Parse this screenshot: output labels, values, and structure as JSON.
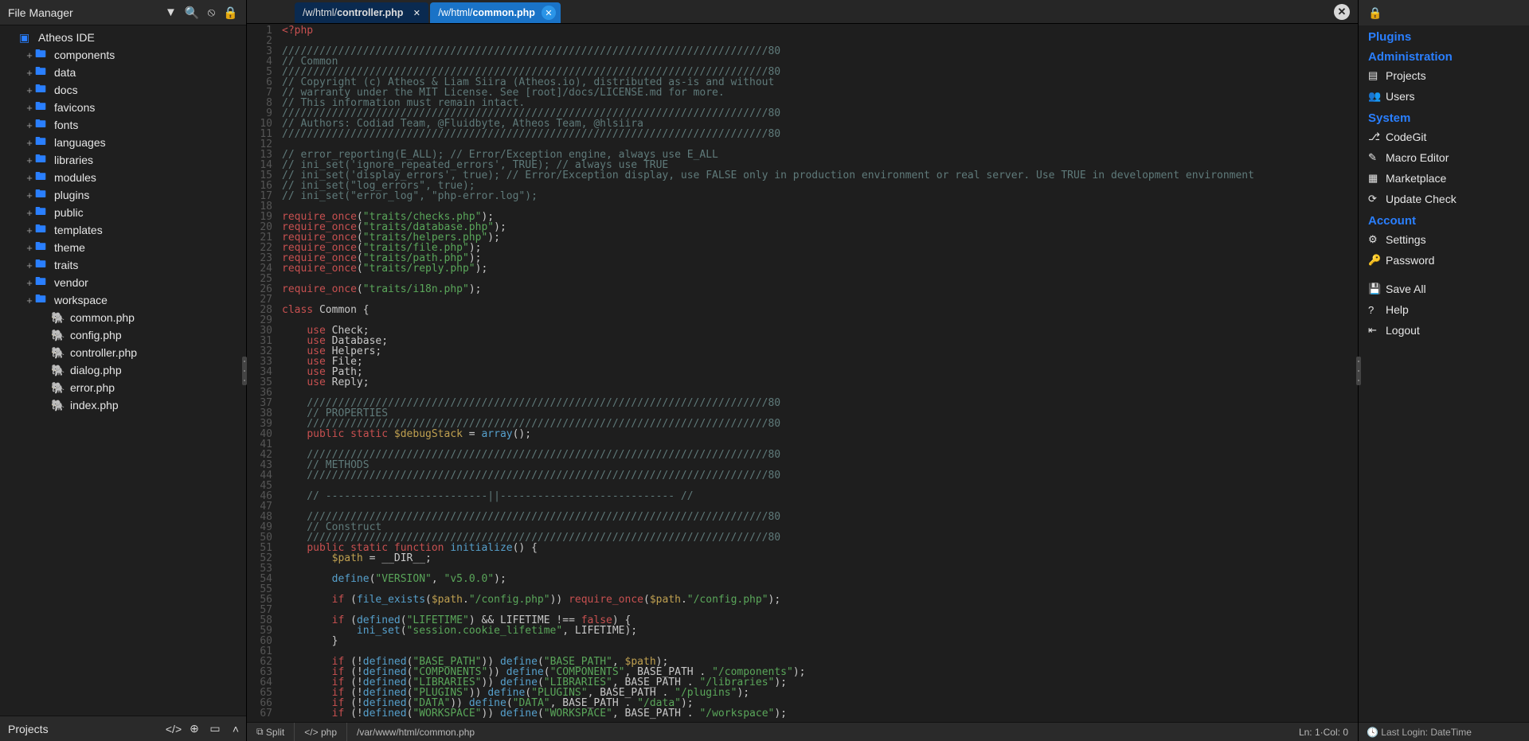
{
  "left": {
    "title": "File Manager",
    "headerIcons": [
      "filter-icon",
      "search-icon",
      "eye-off-icon",
      "lock-icon"
    ],
    "root": "Atheos IDE",
    "folders": [
      "components",
      "data",
      "docs",
      "favicons",
      "fonts",
      "languages",
      "libraries",
      "modules",
      "plugins",
      "public",
      "templates",
      "theme",
      "traits",
      "vendor",
      "workspace"
    ],
    "files": [
      "common.php",
      "config.php",
      "controller.php",
      "dialog.php",
      "error.php",
      "index.php"
    ],
    "bottom": {
      "title": "Projects",
      "icons": [
        "code-icon",
        "plus-circle-icon",
        "archive-icon",
        "chevron-up-icon"
      ]
    }
  },
  "tabs": [
    {
      "prefix": "/w/html/",
      "name": "controller.php",
      "active": false
    },
    {
      "prefix": "/w/html/",
      "name": "common.php",
      "active": true
    }
  ],
  "code": [
    {
      "t": "<?php",
      "c": "c-red"
    },
    {
      "t": "",
      "c": ""
    },
    {
      "t": "//////////////////////////////////////////////////////////////////////////////80",
      "c": "c-cmt"
    },
    {
      "t": "// Common",
      "c": "c-cmt"
    },
    {
      "t": "//////////////////////////////////////////////////////////////////////////////80",
      "c": "c-cmt"
    },
    {
      "t": "// Copyright (c) Atheos & Liam Siira (Atheos.io), distributed as-is and without",
      "c": "c-cmt"
    },
    {
      "t": "// warranty under the MIT License. See [root]/docs/LICENSE.md for more.",
      "c": "c-cmt"
    },
    {
      "t": "// This information must remain intact.",
      "c": "c-cmt"
    },
    {
      "t": "//////////////////////////////////////////////////////////////////////////////80",
      "c": "c-cmt"
    },
    {
      "t": "// Authors: Codiad Team, @Fluidbyte, Atheos Team, @hlsiira",
      "c": "c-cmt"
    },
    {
      "t": "//////////////////////////////////////////////////////////////////////////////80",
      "c": "c-cmt"
    },
    {
      "t": "",
      "c": ""
    },
    {
      "t": "// error_reporting(E_ALL); // Error/Exception engine, always use E_ALL",
      "c": "c-cmt"
    },
    {
      "t": "// ini_set('ignore_repeated_errors', TRUE); // always use TRUE",
      "c": "c-cmt"
    },
    {
      "t": "// ini_set('display_errors', true); // Error/Exception display, use FALSE only in production environment or real server. Use TRUE in development environment",
      "c": "c-cmt"
    },
    {
      "t": "// ini_set(\"log_errors\", true);",
      "c": "c-cmt"
    },
    {
      "t": "// ini_set(\"error_log\", \"php-error.log\");",
      "c": "c-cmt"
    },
    {
      "t": "",
      "c": ""
    },
    {
      "h": "<span class='c-kw'>require_once</span>(<span class='c-str'>\"traits/checks.php\"</span>);"
    },
    {
      "h": "<span class='c-kw'>require_once</span>(<span class='c-str'>\"traits/database.php\"</span>);"
    },
    {
      "h": "<span class='c-kw'>require_once</span>(<span class='c-str'>\"traits/helpers.php\"</span>);"
    },
    {
      "h": "<span class='c-kw'>require_once</span>(<span class='c-str'>\"traits/file.php\"</span>);"
    },
    {
      "h": "<span class='c-kw'>require_once</span>(<span class='c-str'>\"traits/path.php\"</span>);"
    },
    {
      "h": "<span class='c-kw'>require_once</span>(<span class='c-str'>\"traits/reply.php\"</span>);"
    },
    {
      "t": "",
      "c": ""
    },
    {
      "h": "<span class='c-kw'>require_once</span>(<span class='c-str'>\"traits/i18n.php\"</span>);"
    },
    {
      "t": "",
      "c": ""
    },
    {
      "h": "<span class='c-kw'>class</span> Common {"
    },
    {
      "t": "",
      "c": ""
    },
    {
      "h": "    <span class='c-kw'>use</span> Check;"
    },
    {
      "h": "    <span class='c-kw'>use</span> Database;"
    },
    {
      "h": "    <span class='c-kw'>use</span> Helpers;"
    },
    {
      "h": "    <span class='c-kw'>use</span> File;"
    },
    {
      "h": "    <span class='c-kw'>use</span> Path;"
    },
    {
      "h": "    <span class='c-kw'>use</span> Reply;"
    },
    {
      "t": "",
      "c": ""
    },
    {
      "t": "    //////////////////////////////////////////////////////////////////////////80",
      "c": "c-cmt"
    },
    {
      "t": "    // PROPERTIES",
      "c": "c-cmt"
    },
    {
      "t": "    //////////////////////////////////////////////////////////////////////////80",
      "c": "c-cmt"
    },
    {
      "h": "    <span class='c-kw'>public static</span> <span class='c-var'>$debugStack</span> = <span class='c-fn'>array</span>();"
    },
    {
      "t": "",
      "c": ""
    },
    {
      "t": "    //////////////////////////////////////////////////////////////////////////80",
      "c": "c-cmt"
    },
    {
      "t": "    // METHODS",
      "c": "c-cmt"
    },
    {
      "t": "    //////////////////////////////////////////////////////////////////////////80",
      "c": "c-cmt"
    },
    {
      "t": "",
      "c": ""
    },
    {
      "t": "    // --------------------------||---------------------------- //",
      "c": "c-cmt"
    },
    {
      "t": "",
      "c": ""
    },
    {
      "t": "    //////////////////////////////////////////////////////////////////////////80",
      "c": "c-cmt"
    },
    {
      "t": "    // Construct",
      "c": "c-cmt"
    },
    {
      "t": "    //////////////////////////////////////////////////////////////////////////80",
      "c": "c-cmt"
    },
    {
      "h": "    <span class='c-kw'>public static function</span> <span class='c-fn'>initialize</span>() {"
    },
    {
      "h": "        <span class='c-var'>$path</span> = __DIR__;"
    },
    {
      "t": "",
      "c": ""
    },
    {
      "h": "        <span class='c-fn'>define</span>(<span class='c-str'>\"VERSION\"</span>, <span class='c-str'>\"v5.0.0\"</span>);"
    },
    {
      "t": "",
      "c": ""
    },
    {
      "h": "        <span class='c-kw'>if</span> (<span class='c-fn'>file_exists</span>(<span class='c-var'>$path</span>.<span class='c-str'>\"/config.php\"</span>)) <span class='c-kw'>require_once</span>(<span class='c-var'>$path</span>.<span class='c-str'>\"/config.php\"</span>);"
    },
    {
      "t": "",
      "c": ""
    },
    {
      "h": "        <span class='c-kw'>if</span> (<span class='c-fn'>defined</span>(<span class='c-str'>\"LIFETIME\"</span>) &amp;&amp; LIFETIME !== <span class='c-kw'>false</span>) {"
    },
    {
      "h": "            <span class='c-fn'>ini_set</span>(<span class='c-str'>\"session.cookie_lifetime\"</span>, LIFETIME);"
    },
    {
      "t": "        }",
      "c": ""
    },
    {
      "t": "",
      "c": ""
    },
    {
      "h": "        <span class='c-kw'>if</span> (!<span class='c-fn'>defined</span>(<span class='c-str'>\"BASE_PATH\"</span>)) <span class='c-fn'>define</span>(<span class='c-str'>\"BASE_PATH\"</span>, <span class='c-var'>$path</span>);"
    },
    {
      "h": "        <span class='c-kw'>if</span> (!<span class='c-fn'>defined</span>(<span class='c-str'>\"COMPONENTS\"</span>)) <span class='c-fn'>define</span>(<span class='c-str'>\"COMPONENTS\"</span>, BASE_PATH . <span class='c-str'>\"/components\"</span>);"
    },
    {
      "h": "        <span class='c-kw'>if</span> (!<span class='c-fn'>defined</span>(<span class='c-str'>\"LIBRARIES\"</span>)) <span class='c-fn'>define</span>(<span class='c-str'>\"LIBRARIES\"</span>, BASE_PATH . <span class='c-str'>\"/libraries\"</span>);"
    },
    {
      "h": "        <span class='c-kw'>if</span> (!<span class='c-fn'>defined</span>(<span class='c-str'>\"PLUGINS\"</span>)) <span class='c-fn'>define</span>(<span class='c-str'>\"PLUGINS\"</span>, BASE_PATH . <span class='c-str'>\"/plugins\"</span>);"
    },
    {
      "h": "        <span class='c-kw'>if</span> (!<span class='c-fn'>defined</span>(<span class='c-str'>\"DATA\"</span>)) <span class='c-fn'>define</span>(<span class='c-str'>\"DATA\"</span>, BASE_PATH . <span class='c-str'>\"/data\"</span>);"
    },
    {
      "h": "        <span class='c-kw'>if</span> (!<span class='c-fn'>defined</span>(<span class='c-str'>\"WORKSPACE\"</span>)) <span class='c-fn'>define</span>(<span class='c-str'>\"WORKSPACE\"</span>, BASE_PATH . <span class='c-str'>\"/workspace\"</span>);"
    }
  ],
  "status": {
    "split": "Split",
    "lang": "php",
    "path": "/var/www/html/common.php",
    "pos": "Ln: 1·Col: 0"
  },
  "right": {
    "plugins": "Plugins",
    "sections": [
      {
        "title": "Administration",
        "items": [
          {
            "icon": "▤",
            "label": "Projects",
            "name": "admin-projects"
          },
          {
            "icon": "👥",
            "label": "Users",
            "name": "admin-users"
          }
        ]
      },
      {
        "title": "System",
        "items": [
          {
            "icon": "⎇",
            "label": "CodeGit",
            "name": "system-codegit"
          },
          {
            "icon": "✎",
            "label": "Macro Editor",
            "name": "system-macro"
          },
          {
            "icon": "▦",
            "label": "Marketplace",
            "name": "system-marketplace"
          },
          {
            "icon": "⟳",
            "label": "Update Check",
            "name": "system-update"
          }
        ]
      },
      {
        "title": "Account",
        "items": [
          {
            "icon": "⚙",
            "label": "Settings",
            "name": "account-settings"
          },
          {
            "icon": "🔑",
            "label": "Password",
            "name": "account-password"
          }
        ]
      }
    ],
    "extra": [
      {
        "icon": "💾",
        "label": "Save All",
        "name": "save-all"
      },
      {
        "icon": "?",
        "label": "Help",
        "name": "help"
      },
      {
        "icon": "⇤",
        "label": "Logout",
        "name": "logout"
      }
    ],
    "footer": "Last Login: DateTime"
  },
  "glyphs": {
    "filter-icon": "▼",
    "search-icon": "🔍",
    "eye-off-icon": "⦸",
    "lock-icon": "🔒",
    "code-icon": "</>",
    "plus-circle-icon": "⊕",
    "archive-icon": "▭",
    "chevron-up-icon": "˄",
    "split-icon": "⧉",
    "lang-icon": "</>",
    "clock-icon": "🕓"
  }
}
